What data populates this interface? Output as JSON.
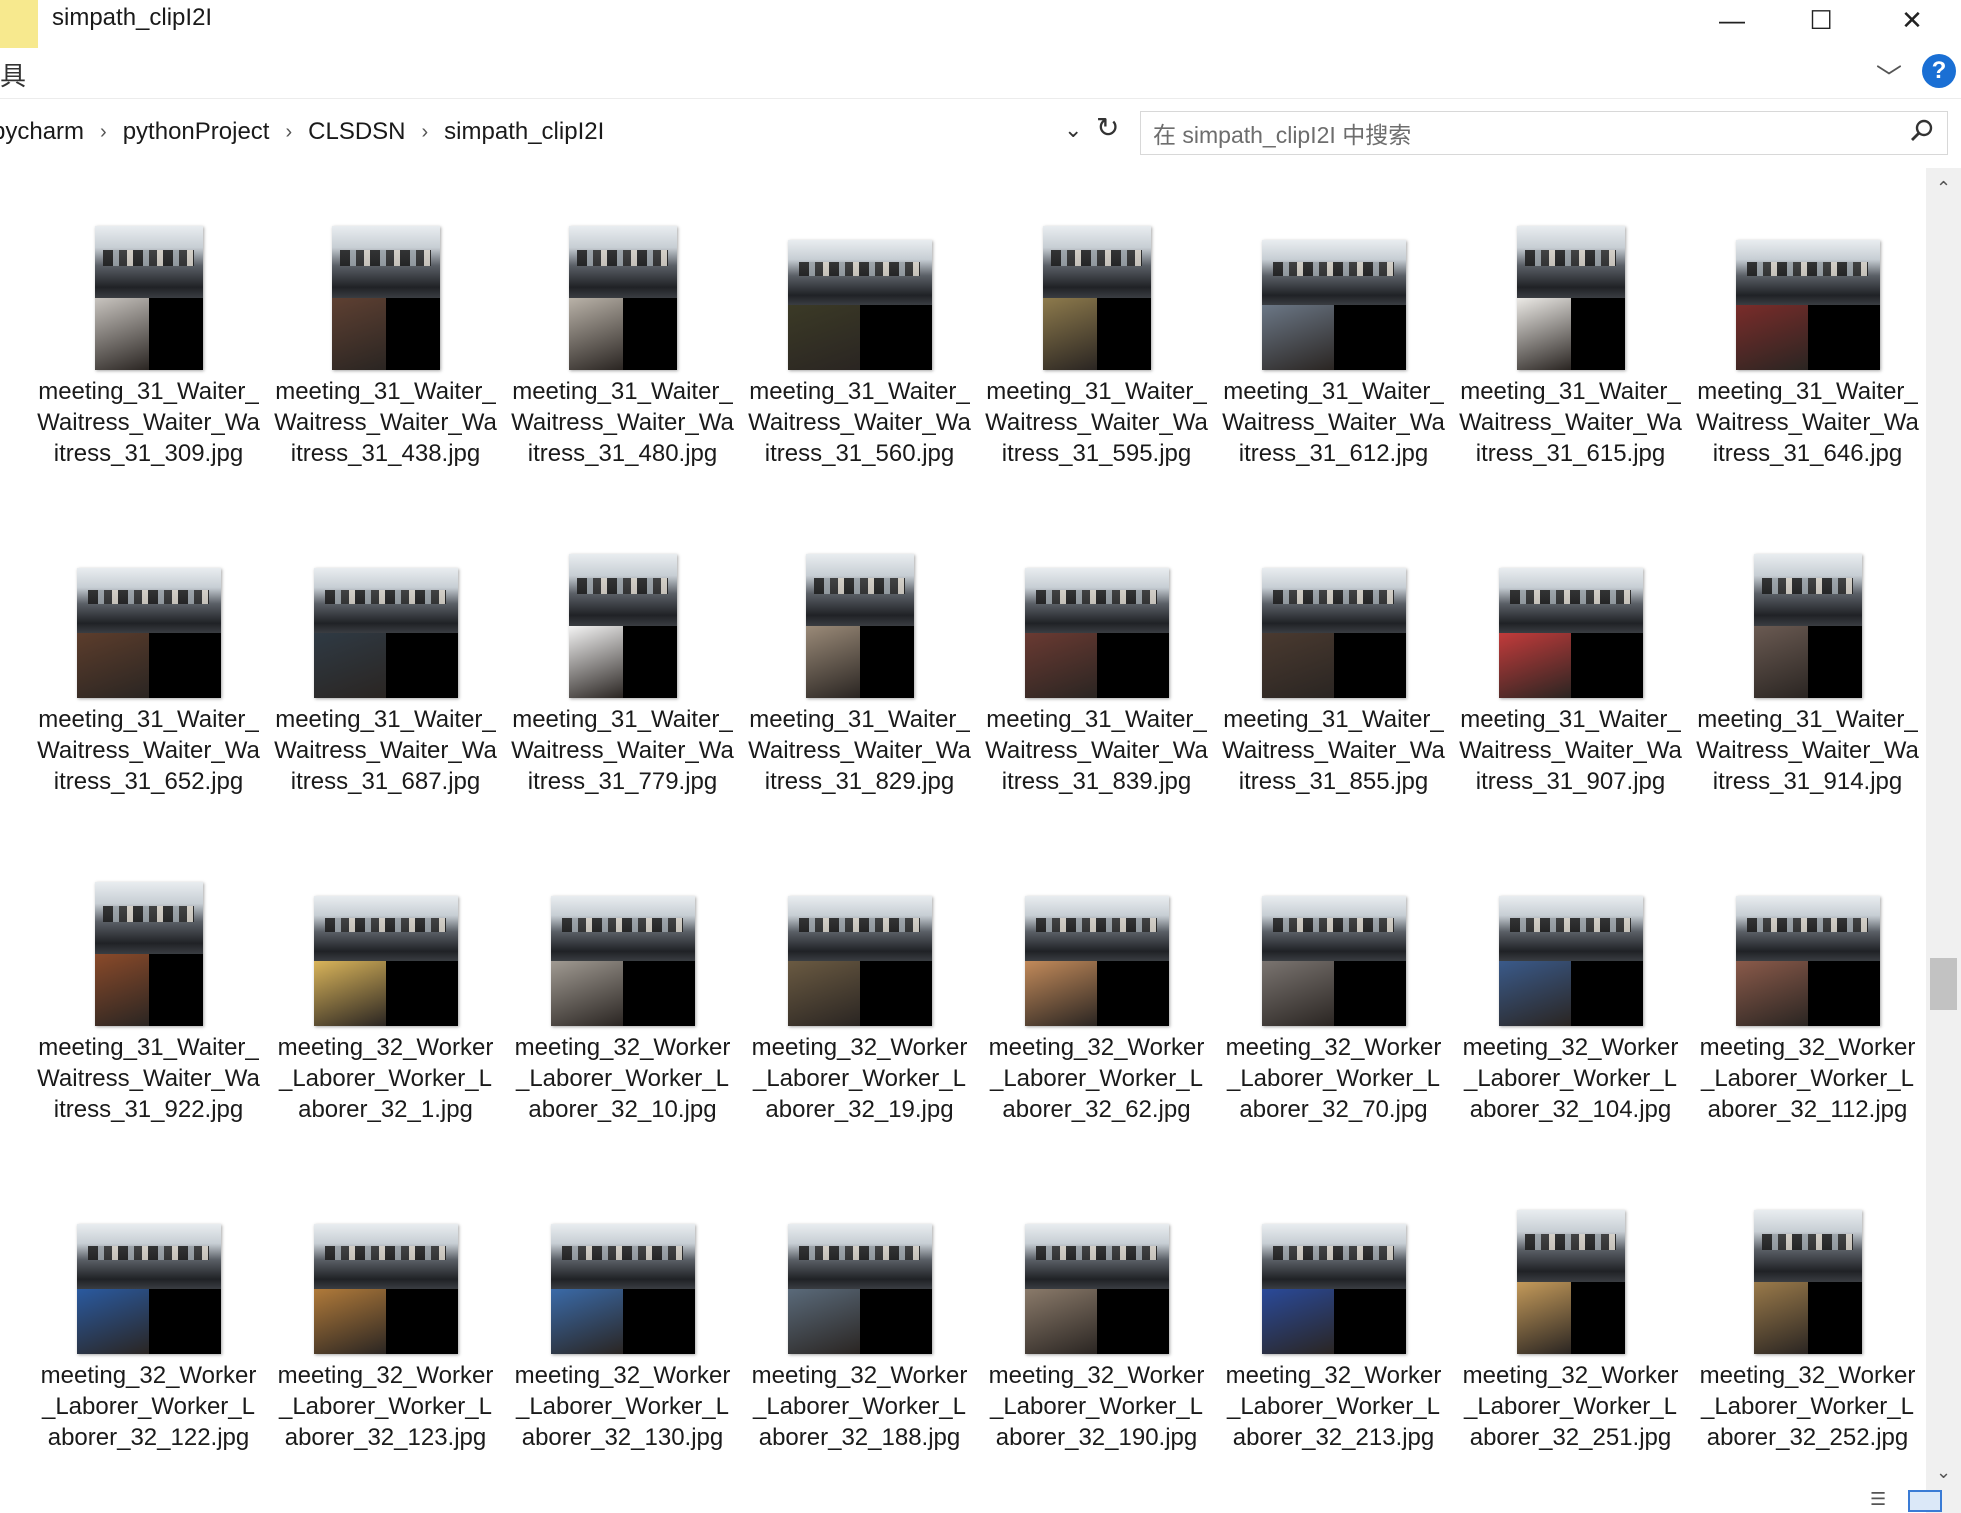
{
  "window": {
    "title": "simpath_clipI2I",
    "minimize_glyph": "—",
    "maximize_glyph": "☐",
    "close_glyph": "✕"
  },
  "ribbon": {
    "left_glyph": "具",
    "expand_glyph": "﹀",
    "help_glyph": "?"
  },
  "address": {
    "breadcrumbs": [
      "pycharm",
      "pythonProject",
      "CLSDSN",
      "simpath_clipI2I"
    ],
    "separator": "›",
    "dropdown_glyph": "⌄",
    "refresh_glyph": "↻"
  },
  "search": {
    "placeholder": "在 simpath_clipI2I 中搜索",
    "icon": "search-icon"
  },
  "scrollbar": {
    "up_glyph": "⌃",
    "down_glyph": "⌄"
  },
  "files": [
    {
      "name": "meeting_31_Waiter_Waitress_Waiter_Waitress_31_309.jpg",
      "shape": "tall",
      "tone": "#c8c4bf"
    },
    {
      "name": "meeting_31_Waiter_Waitress_Waiter_Waitress_31_438.jpg",
      "shape": "tall",
      "tone": "#5e4032"
    },
    {
      "name": "meeting_31_Waiter_Waitress_Waiter_Waitress_31_480.jpg",
      "shape": "tall",
      "tone": "#b9b2a8"
    },
    {
      "name": "meeting_31_Waiter_Waitress_Waiter_Waitress_31_560.jpg",
      "shape": "wide",
      "tone": "#3b3a26"
    },
    {
      "name": "meeting_31_Waiter_Waitress_Waiter_Waitress_31_595.jpg",
      "shape": "tall",
      "tone": "#8d7a4c"
    },
    {
      "name": "meeting_31_Waiter_Waitress_Waiter_Waitress_31_612.jpg",
      "shape": "wide",
      "tone": "#6b7786"
    },
    {
      "name": "meeting_31_Waiter_Waitress_Waiter_Waitress_31_615.jpg",
      "shape": "tall",
      "tone": "#eceae6"
    },
    {
      "name": "meeting_31_Waiter_Waitress_Waiter_Waitress_31_646.jpg",
      "shape": "wide",
      "tone": "#7a2c2a"
    },
    {
      "name": "meeting_31_Waiter_Waitress_Waiter_Waitress_31_652.jpg",
      "shape": "wide",
      "tone": "#5c3d2c"
    },
    {
      "name": "meeting_31_Waiter_Waitress_Waiter_Waitress_31_687.jpg",
      "shape": "wide",
      "tone": "#2f3a44"
    },
    {
      "name": "meeting_31_Waiter_Waitress_Waiter_Waitress_31_779.jpg",
      "shape": "tall",
      "tone": "#f4f4f4"
    },
    {
      "name": "meeting_31_Waiter_Waitress_Waiter_Waitress_31_829.jpg",
      "shape": "tall",
      "tone": "#9a8a78"
    },
    {
      "name": "meeting_31_Waiter_Waitress_Waiter_Waitress_31_839.jpg",
      "shape": "wide",
      "tone": "#6a3a32"
    },
    {
      "name": "meeting_31_Waiter_Waitress_Waiter_Waitress_31_855.jpg",
      "shape": "wide",
      "tone": "#4a3a30"
    },
    {
      "name": "meeting_31_Waiter_Waitress_Waiter_Waitress_31_907.jpg",
      "shape": "wide",
      "tone": "#c23b3b"
    },
    {
      "name": "meeting_31_Waiter_Waitress_Waiter_Waitress_31_914.jpg",
      "shape": "tall",
      "tone": "#6a5a52"
    },
    {
      "name": "meeting_31_Waiter_Waitress_Waiter_Waitress_31_922.jpg",
      "shape": "tall",
      "tone": "#8a4a2a"
    },
    {
      "name": "meeting_32_Worker_Laborer_Worker_Laborer_32_1.jpg",
      "shape": "wide",
      "tone": "#d9b45a"
    },
    {
      "name": "meeting_32_Worker_Laborer_Worker_Laborer_32_10.jpg",
      "shape": "wide",
      "tone": "#a09a92"
    },
    {
      "name": "meeting_32_Worker_Laborer_Worker_Laborer_32_19.jpg",
      "shape": "wide",
      "tone": "#6a5a42"
    },
    {
      "name": "meeting_32_Worker_Laborer_Worker_Laborer_32_62.jpg",
      "shape": "wide",
      "tone": "#c28a5a"
    },
    {
      "name": "meeting_32_Worker_Laborer_Worker_Laborer_32_70.jpg",
      "shape": "wide",
      "tone": "#7a7470"
    },
    {
      "name": "meeting_32_Worker_Laborer_Worker_Laborer_32_104.jpg",
      "shape": "wide",
      "tone": "#3a5a8a"
    },
    {
      "name": "meeting_32_Worker_Laborer_Worker_Laborer_32_112.jpg",
      "shape": "wide",
      "tone": "#8a5a4a"
    },
    {
      "name": "meeting_32_Worker_Laborer_Worker_Laborer_32_122.jpg",
      "shape": "wide",
      "tone": "#2a5aa0"
    },
    {
      "name": "meeting_32_Worker_Laborer_Worker_Laborer_32_123.jpg",
      "shape": "wide",
      "tone": "#b07a3a"
    },
    {
      "name": "meeting_32_Worker_Laborer_Worker_Laborer_32_130.jpg",
      "shape": "wide",
      "tone": "#3a6aa8"
    },
    {
      "name": "meeting_32_Worker_Laborer_Worker_Laborer_32_188.jpg",
      "shape": "wide",
      "tone": "#5a6a7a"
    },
    {
      "name": "meeting_32_Worker_Laborer_Worker_Laborer_32_190.jpg",
      "shape": "wide",
      "tone": "#8a7a6a"
    },
    {
      "name": "meeting_32_Worker_Laborer_Worker_Laborer_32_213.jpg",
      "shape": "wide",
      "tone": "#2a4a9a"
    },
    {
      "name": "meeting_32_Worker_Laborer_Worker_Laborer_32_251.jpg",
      "shape": "tall",
      "tone": "#c49a5a"
    },
    {
      "name": "meeting_32_Worker_Laborer_Worker_Laborer_32_252.jpg",
      "shape": "tall",
      "tone": "#9a7a4a"
    }
  ]
}
